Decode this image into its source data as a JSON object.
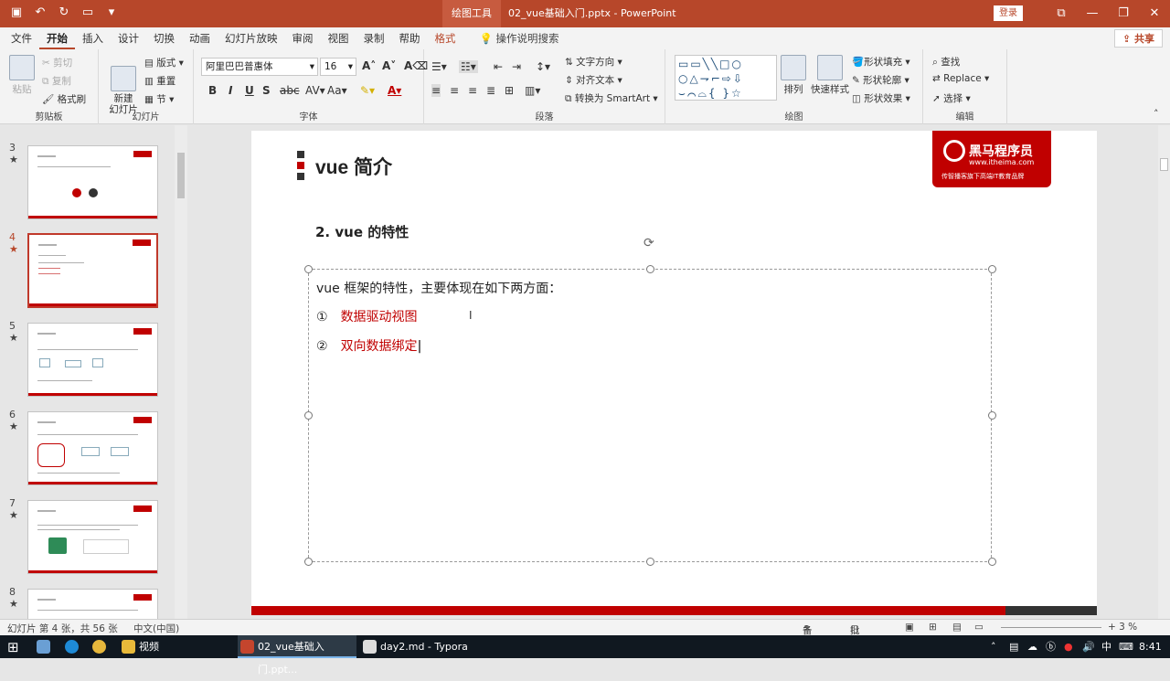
{
  "titlebar": {
    "context_tool": "绘图工具",
    "doc_title": "02_vue基础入门.pptx - PowerPoint",
    "login": "登录",
    "qat_icons": [
      "save-icon",
      "undo-icon",
      "redo-icon",
      "present-icon",
      "customize-icon"
    ]
  },
  "tabs": {
    "items": [
      "文件",
      "开始",
      "插入",
      "设计",
      "切换",
      "动画",
      "幻灯片放映",
      "审阅",
      "视图",
      "录制",
      "帮助",
      "格式"
    ],
    "active": "开始",
    "search": "操作说明搜索",
    "share": "共享"
  },
  "ribbon": {
    "clipboard": {
      "label": "剪贴板",
      "paste": "粘贴",
      "cut": "剪切",
      "copy": "复制",
      "format_painter": "格式刷"
    },
    "slides": {
      "label": "幻灯片",
      "new_slide": "新建\n幻灯片",
      "layout": "版式",
      "reset": "重置",
      "section": "节"
    },
    "font": {
      "label": "字体",
      "name": "阿里巴巴普惠体",
      "size": "16"
    },
    "paragraph": {
      "label": "段落",
      "text_direction": "文字方向",
      "align_text": "对齐文本",
      "smartart": "转换为 SmartArt"
    },
    "drawing": {
      "label": "绘图",
      "arrange": "排列",
      "quick_styles": "快速样式",
      "fill": "形状填充",
      "outline": "形状轮廓",
      "effects": "形状效果"
    },
    "editing": {
      "label": "编辑",
      "find": "查找",
      "replace": "Replace",
      "select": "选择"
    }
  },
  "thumbnails": [
    {
      "num": "3",
      "star": "★"
    },
    {
      "num": "4",
      "star": "★",
      "active": true
    },
    {
      "num": "5",
      "star": "★"
    },
    {
      "num": "6",
      "star": "★"
    },
    {
      "num": "7",
      "star": "★"
    },
    {
      "num": "8",
      "star": "★"
    }
  ],
  "slide": {
    "title": "vue 简介",
    "logo_name": "黑马程序员",
    "logo_url": "www.itheima.com",
    "logo_tagline": "传智播客旗下高端IT教育品牌",
    "subtitle": "2. vue 的特性",
    "intro": "vue 框架的特性，主要体现在如下两方面：",
    "items": [
      {
        "marker": "①",
        "text": "数据驱动视图"
      },
      {
        "marker": "②",
        "text": "双向数据绑定"
      }
    ],
    "colors": {
      "accent": "#c00000",
      "dark": "#333333"
    }
  },
  "status": {
    "slide_info": "幻灯片 第 4 张，共 56 张",
    "language": "中文(中国)",
    "notes": "备注",
    "comments": "批注",
    "zoom": "+ 3 %"
  },
  "taskbar": {
    "tasks": [
      "视频",
      "02_vue基础入门.ppt...",
      "day2.md - Typora"
    ],
    "ime": "中",
    "time": "8:41"
  }
}
